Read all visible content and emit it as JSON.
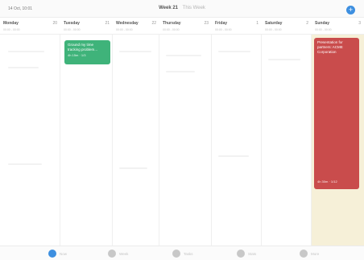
{
  "header": {
    "date": "14 Oct, 10:01",
    "week_label": "Week 21",
    "week_sub": "This Week",
    "add_icon": "plus-icon",
    "accent": "#3d8fe0"
  },
  "days": [
    {
      "name": "Monday",
      "num": "20",
      "sub": "00:00 - 00:00"
    },
    {
      "name": "Tuesday",
      "num": "21",
      "sub": "00:00 - 00:00"
    },
    {
      "name": "Wednesday",
      "num": "22",
      "sub": "00:00 - 00:00"
    },
    {
      "name": "Thursday",
      "num": "23",
      "sub": "00:00 - 00:00"
    },
    {
      "name": "Friday",
      "num": "1",
      "sub": "00:00 - 00:00"
    },
    {
      "name": "Saturday",
      "num": "2",
      "sub": "00:00 - 00:00"
    },
    {
      "name": "Sunday",
      "num": "3",
      "sub": "00:00 - 00:00",
      "today": true
    }
  ],
  "events": [
    {
      "title": "Ground my time tracking problem...",
      "meta": "4h 15m · 1/3",
      "color": "#3fb37a",
      "day": "Tuesday"
    },
    {
      "title": "Presentation for partners: ACME Corporation",
      "meta": "4h 30m · 1/12",
      "color": "#c94c4c",
      "day": "Sunday"
    }
  ],
  "tabs": [
    {
      "label": "Now",
      "icon": "calendar-icon",
      "active": true
    },
    {
      "label": "Week",
      "icon": "list-icon"
    },
    {
      "label": "Tasks",
      "icon": "tasks-icon"
    },
    {
      "label": "Stats",
      "icon": "stats-icon"
    },
    {
      "label": "More",
      "icon": "search-icon"
    }
  ]
}
